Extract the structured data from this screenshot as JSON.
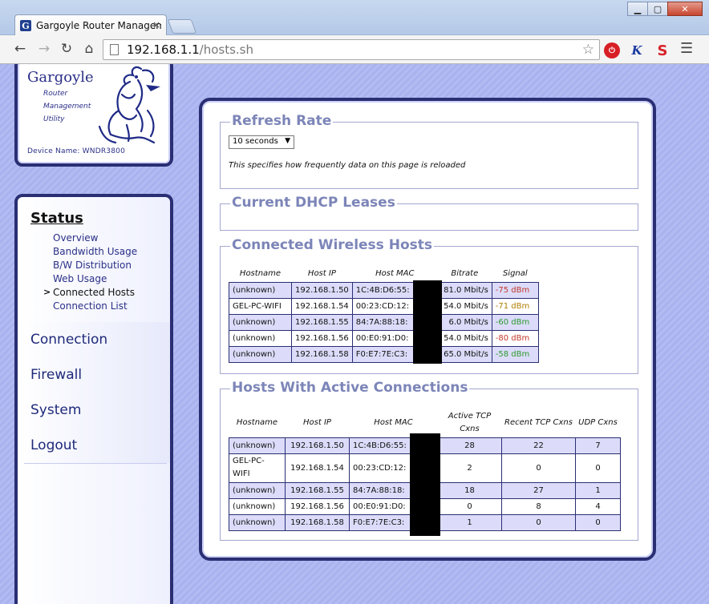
{
  "browser": {
    "tab_title": "Gargoyle Router Managem",
    "tab_close": "×",
    "url_host": "192.168.1.1",
    "url_path": "/hosts.sh",
    "favicon": "G"
  },
  "logo": {
    "title": "Gargoyle",
    "sub1": "Router",
    "sub2": "Management",
    "sub3": "Utility",
    "device_name": "Device Name:  WNDR3800"
  },
  "nav": {
    "section": "Status",
    "items": [
      "Overview",
      "Bandwidth Usage",
      "B/W Distribution",
      "Web Usage",
      "Connected Hosts",
      "Connection List"
    ],
    "current_marker": ">",
    "main": [
      "Connection",
      "Firewall",
      "System",
      "Logout"
    ]
  },
  "refresh": {
    "title": "Refresh Rate",
    "selected": "10 seconds",
    "help": "This specifies how frequently data on this page is reloaded"
  },
  "dhcp": {
    "title": "Current DHCP Leases"
  },
  "wireless": {
    "title": "Connected Wireless Hosts",
    "headers": [
      "Hostname",
      "Host IP",
      "Host MAC",
      "Bitrate",
      "Signal"
    ],
    "rows": [
      {
        "hostname": "(unknown)",
        "ip": "192.168.1.50",
        "mac": "1C:4B:D6:55:",
        "bitrate": "81.0 Mbit/s",
        "signal": "-75 dBm",
        "signal_color": "#c0392b"
      },
      {
        "hostname": "GEL-PC-WIFI",
        "ip": "192.168.1.54",
        "mac": "00:23:CD:12:",
        "bitrate": "54.0 Mbit/s",
        "signal": "-71 dBm",
        "signal_color": "#b07d00"
      },
      {
        "hostname": "(unknown)",
        "ip": "192.168.1.55",
        "mac": "84:7A:88:18:",
        "bitrate": "6.0 Mbit/s",
        "signal": "-60 dBm",
        "signal_color": "#2e9a2e"
      },
      {
        "hostname": "(unknown)",
        "ip": "192.168.1.56",
        "mac": "00:E0:91:D0:",
        "bitrate": "54.0 Mbit/s",
        "signal": "-80 dBm",
        "signal_color": "#c0392b"
      },
      {
        "hostname": "(unknown)",
        "ip": "192.168.1.58",
        "mac": "F0:E7:7E:C3:",
        "bitrate": "65.0 Mbit/s",
        "signal": "-58 dBm",
        "signal_color": "#2e9a2e"
      }
    ]
  },
  "active": {
    "title": "Hosts With Active Connections",
    "headers": [
      "Hostname",
      "Host IP",
      "Host MAC",
      "Active TCP Cxns",
      "Recent TCP Cxns",
      "UDP Cxns"
    ],
    "rows": [
      {
        "hostname": "(unknown)",
        "ip": "192.168.1.50",
        "mac": "1C:4B:D6:55:",
        "active_tcp": "28",
        "recent_tcp": "22",
        "udp": "7"
      },
      {
        "hostname": "GEL-PC-WIFI",
        "ip": "192.168.1.54",
        "mac": "00:23:CD:12:",
        "active_tcp": "2",
        "recent_tcp": "0",
        "udp": "0"
      },
      {
        "hostname": "(unknown)",
        "ip": "192.168.1.55",
        "mac": "84:7A:88:18:",
        "active_tcp": "18",
        "recent_tcp": "27",
        "udp": "1"
      },
      {
        "hostname": "(unknown)",
        "ip": "192.168.1.56",
        "mac": "00:E0:91:D0:",
        "active_tcp": "0",
        "recent_tcp": "8",
        "udp": "4"
      },
      {
        "hostname": "(unknown)",
        "ip": "192.168.1.58",
        "mac": "F0:E7:7E:C3:",
        "active_tcp": "1",
        "recent_tcp": "0",
        "udp": "0"
      }
    ]
  }
}
